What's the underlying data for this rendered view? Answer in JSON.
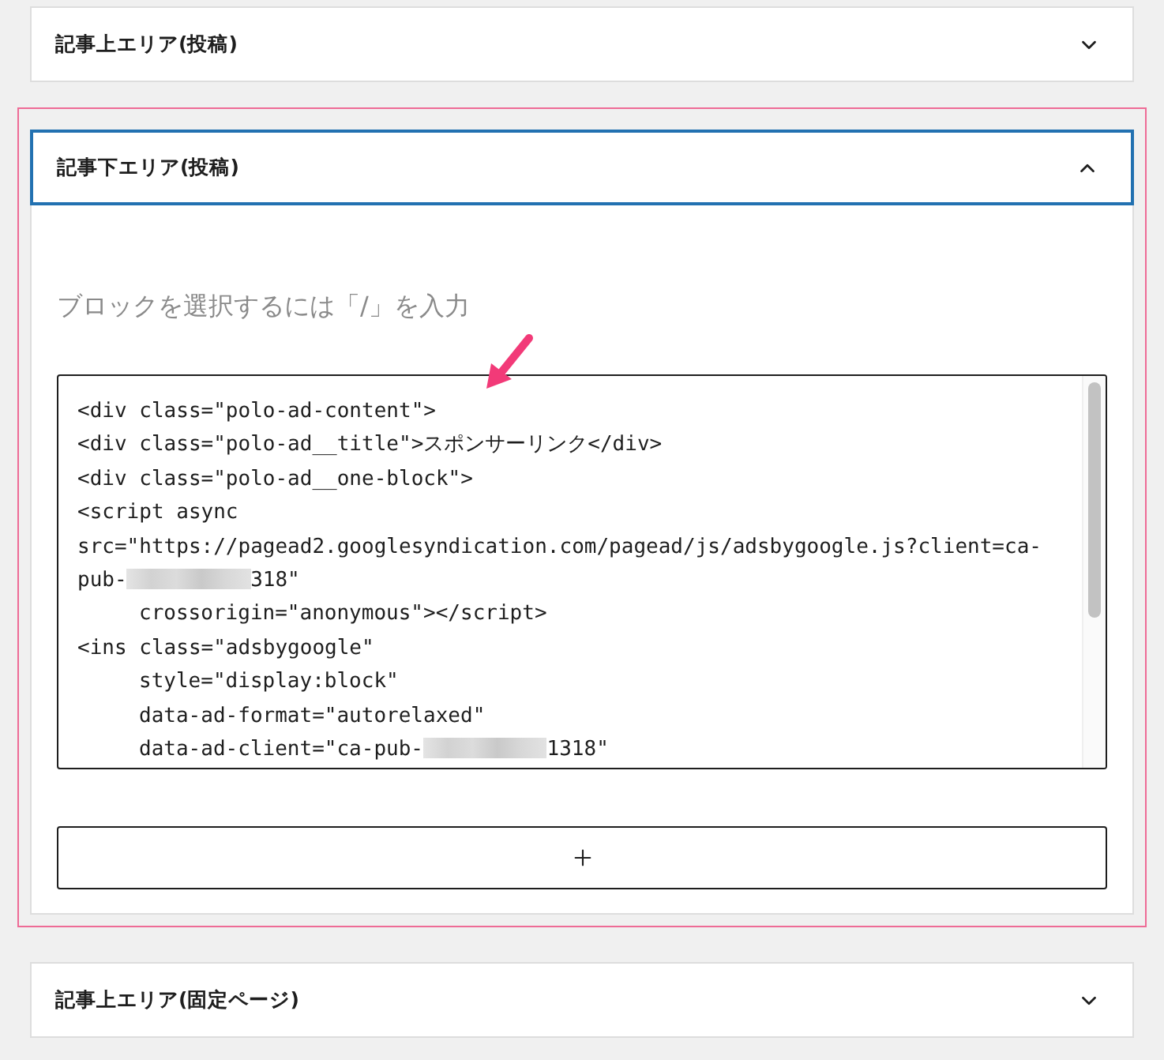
{
  "panels": [
    {
      "title": "記事上エリア(投稿)",
      "expanded": false,
      "selected": false
    },
    {
      "title": "記事下エリア(投稿)",
      "expanded": true,
      "selected": true,
      "body": {
        "placeholder": "ブロックを選択するには「/」を入力",
        "code_block": {
          "lines": [
            {
              "indented": false,
              "segments": [
                {
                  "kind": "text",
                  "text": "<div class=\"polo-ad-content\">"
                }
              ]
            },
            {
              "indented": false,
              "segments": [
                {
                  "kind": "text",
                  "text": "<div class=\"polo-ad__title\">スポンサーリンク</div>"
                }
              ]
            },
            {
              "indented": false,
              "segments": [
                {
                  "kind": "text",
                  "text": "<div class=\"polo-ad__one-block\">"
                }
              ]
            },
            {
              "indented": false,
              "segments": [
                {
                  "kind": "text",
                  "text": "<script async"
                }
              ]
            },
            {
              "indented": false,
              "segments": [
                {
                  "kind": "text",
                  "text": "src=\"https://pagead2.googlesyndication.com/pagead/js/adsbygoogle.js?client=ca-"
                }
              ]
            },
            {
              "indented": false,
              "segments": [
                {
                  "kind": "text",
                  "text": "pub-"
                },
                {
                  "kind": "redacted"
                },
                {
                  "kind": "text",
                  "text": "318\""
                }
              ]
            },
            {
              "indented": true,
              "segments": [
                {
                  "kind": "text",
                  "text": "crossorigin=\"anonymous\"></script>"
                }
              ]
            },
            {
              "indented": false,
              "segments": [
                {
                  "kind": "text",
                  "text": "<ins class=\"adsbygoogle\""
                }
              ]
            },
            {
              "indented": true,
              "segments": [
                {
                  "kind": "text",
                  "text": "style=\"display:block\""
                }
              ]
            },
            {
              "indented": true,
              "segments": [
                {
                  "kind": "text",
                  "text": "data-ad-format=\"autorelaxed\""
                }
              ]
            },
            {
              "indented": true,
              "segments": [
                {
                  "kind": "text",
                  "text": "data-ad-client=\"ca-pub-"
                },
                {
                  "kind": "redacted"
                },
                {
                  "kind": "text",
                  "text": "1318\""
                }
              ]
            }
          ]
        },
        "add_button": {
          "kind": "plus"
        }
      }
    },
    {
      "title": "記事上エリア(固定ページ)",
      "expanded": false,
      "selected": false
    }
  ]
}
